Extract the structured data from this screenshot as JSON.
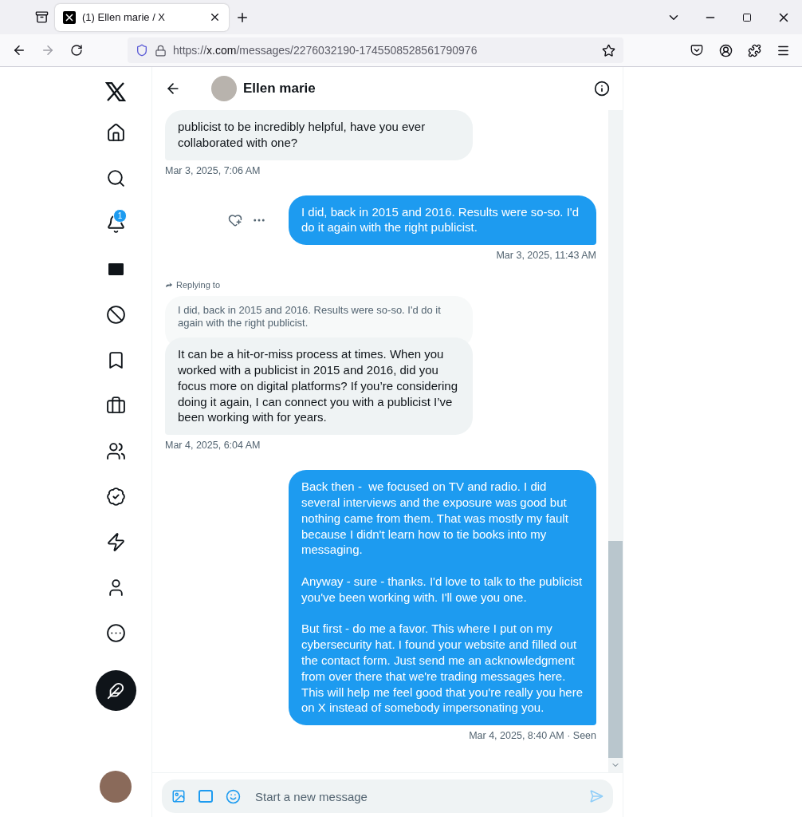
{
  "browser": {
    "tabs": [
      {
        "title": "(1) Ellen marie / X",
        "selected": true
      }
    ],
    "url": {
      "scheme": "https://",
      "host": "x.com",
      "path": "/messages/2276032190-1745508528561790976"
    }
  },
  "sidebar": {
    "items": [
      {
        "kind": "home"
      },
      {
        "kind": "search"
      },
      {
        "kind": "notifications",
        "badge": "1"
      },
      {
        "kind": "messages"
      },
      {
        "kind": "grok"
      },
      {
        "kind": "bookmarks"
      },
      {
        "kind": "jobs"
      },
      {
        "kind": "communities"
      },
      {
        "kind": "verified"
      },
      {
        "kind": "lightning"
      },
      {
        "kind": "profile"
      },
      {
        "kind": "more"
      }
    ]
  },
  "conversation": {
    "name": "Ellen marie",
    "messages": [
      {
        "kind": "received",
        "show_actions": false,
        "text": "publicist to be incredibly helpful, have you ever collaborated with one?",
        "timestamp": "Mar 3, 2025, 7:06 AM"
      },
      {
        "kind": "sent",
        "show_actions": true,
        "text": "I did, back in 2015 and 2016. Results were so-so. I'd do it again with the right publicist.",
        "timestamp": "Mar 3, 2025, 11:43 AM"
      },
      {
        "kind": "received",
        "show_actions": false,
        "reply_label": "Replying to",
        "reply_text": "I did, back in 2015 and 2016. Results were so-so. I'd do it again with the right publicist.",
        "text": "It can be a hit-or-miss process at times. When you worked with a publicist in 2015 and 2016, did you focus more on digital platforms? If you’re considering doing it again, I can connect you with a publicist I’ve been working with for years.",
        "timestamp": "Mar 4, 2025, 6:04 AM"
      },
      {
        "kind": "sent",
        "show_actions": false,
        "text": "Back then -  we focused on TV and radio. I did several interviews and the exposure was good but nothing came from them. That was mostly my fault because I didn't learn how to tie books into my messaging.\n\nAnyway - sure - thanks. I'd love to talk to the publicist you've been working with. I'll owe you one.\n\nBut first - do me a favor. This where I put on my cybersecurity hat. I found your website and filled out the contact form. Just send me an acknowledgment from over there that we're trading messages here. This will help me feel good that you're really you here on X instead of somebody impersonating you.",
        "timestamp": "Mar 4, 2025, 8:40 AM · Seen"
      }
    ]
  },
  "composer": {
    "placeholder": "Start a new message",
    "send_disabled": true
  }
}
